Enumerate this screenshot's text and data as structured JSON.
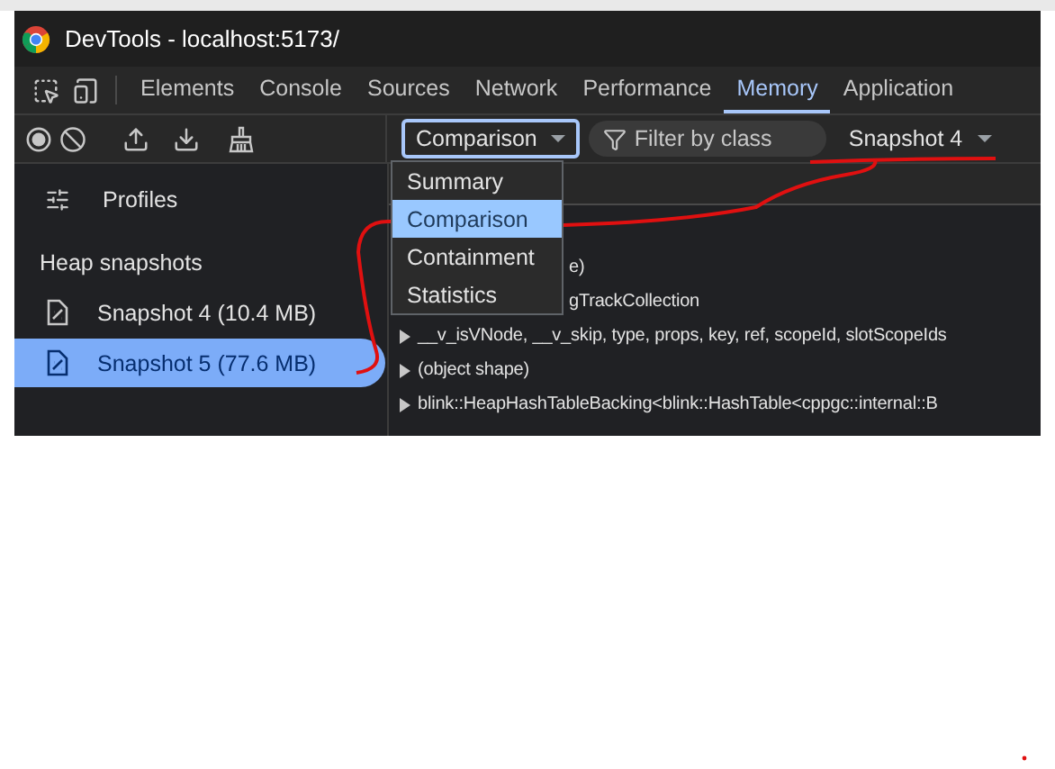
{
  "window": {
    "title": "DevTools - localhost:5173/"
  },
  "tabs": [
    {
      "label": "Elements",
      "selected": false
    },
    {
      "label": "Console",
      "selected": false
    },
    {
      "label": "Sources",
      "selected": false
    },
    {
      "label": "Network",
      "selected": false
    },
    {
      "label": "Performance",
      "selected": false
    },
    {
      "label": "Memory",
      "selected": true
    },
    {
      "label": "Application",
      "selected": false
    }
  ],
  "toolbar": {
    "view_select": {
      "value": "Comparison",
      "expanded": true,
      "options": [
        {
          "label": "Summary",
          "selected": false
        },
        {
          "label": "Comparison",
          "selected": true
        },
        {
          "label": "Containment",
          "selected": false
        },
        {
          "label": "Statistics",
          "selected": false
        }
      ]
    },
    "filter": {
      "placeholder": "Filter by class"
    },
    "baseline_select": {
      "value": "Snapshot 4"
    }
  },
  "sidebar": {
    "profiles_label": "Profiles",
    "section_heading": "Heap snapshots",
    "items": [
      {
        "label": "Snapshot 4 (10.4 MB)",
        "selected": false
      },
      {
        "label": "Snapshot 5 (77.6 MB)",
        "selected": true
      }
    ]
  },
  "rows": [
    {
      "text": "e)",
      "covered": true
    },
    {
      "text": "gTrackCollection",
      "covered": true
    },
    {
      "text": "__v_isVNode, __v_skip, type, props, key, ref, scopeId, slotScopeIds",
      "covered": false
    },
    {
      "text": "(object shape)",
      "covered": false
    },
    {
      "text": "blink::HeapHashTableBacking<blink::HashTable<cppgc::internal::B",
      "covered": false
    }
  ]
}
